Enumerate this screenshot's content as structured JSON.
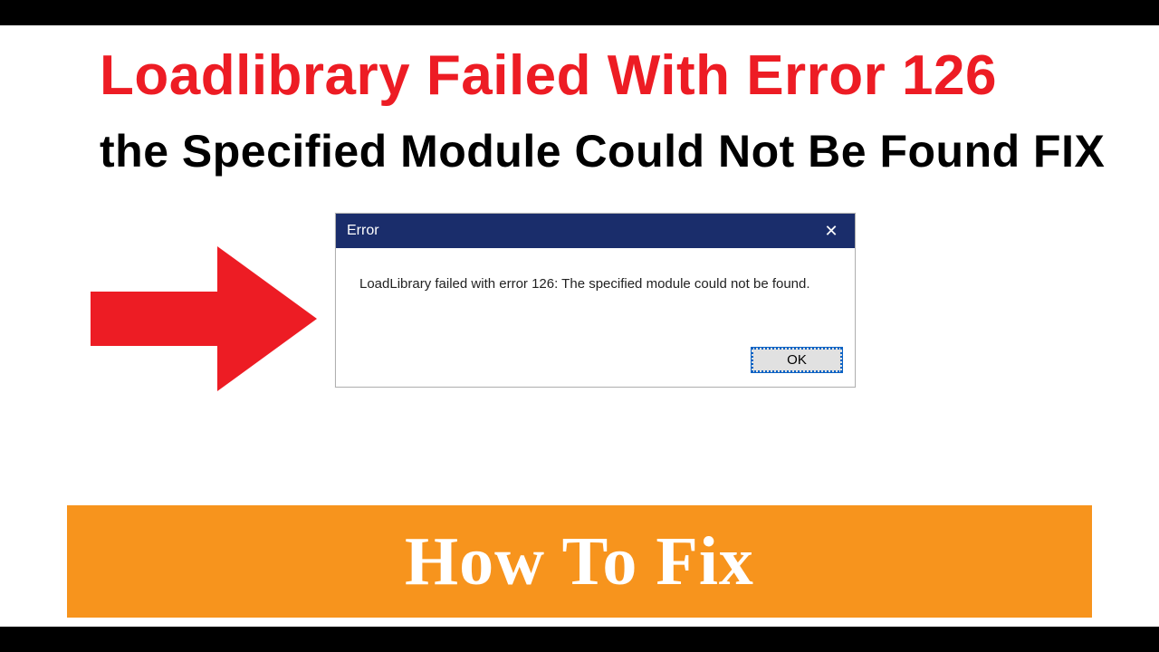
{
  "headline": {
    "red": "Loadlibrary Failed With Error 126",
    "black": "the Specified Module Could Not Be Found FIX"
  },
  "dialog": {
    "title": "Error",
    "close_glyph": "✕",
    "message": "LoadLibrary failed with error 126: The specified module could not be found.",
    "ok_label": "OK"
  },
  "banner": {
    "text": "How To Fix"
  },
  "colors": {
    "red": "#ed1c24",
    "orange": "#f7941d",
    "titlebar": "#1a2d6b"
  }
}
